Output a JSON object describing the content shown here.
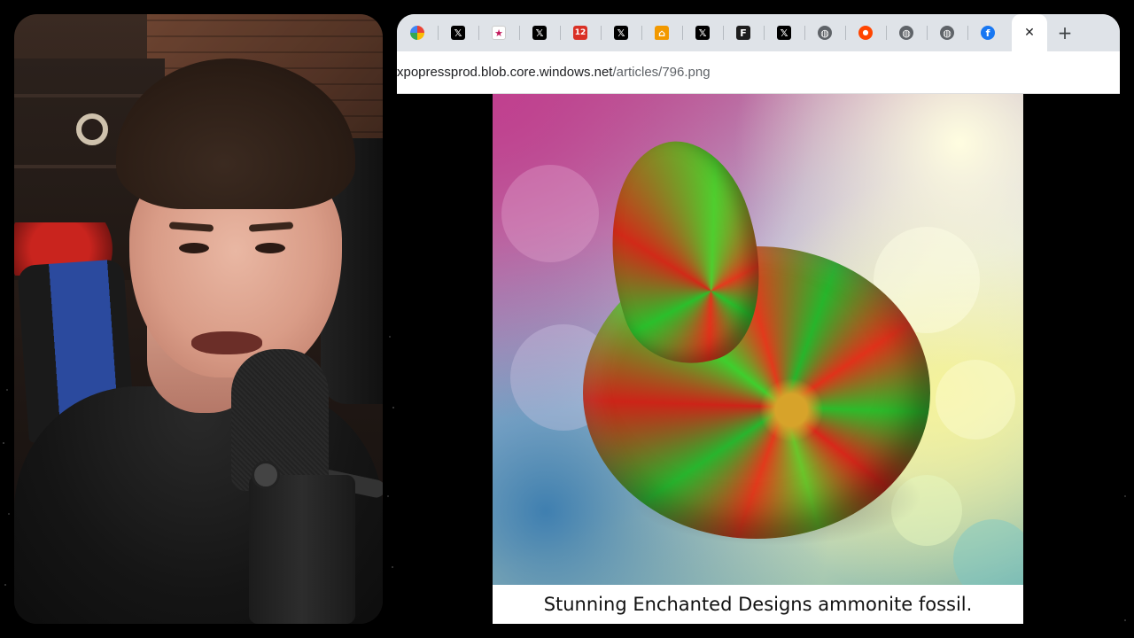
{
  "browser": {
    "tabs": [
      {
        "icon": "multicolor-app-icon",
        "glyph": ""
      },
      {
        "icon": "x-icon",
        "glyph": "𝕏"
      },
      {
        "icon": "star-logo-icon",
        "glyph": "★"
      },
      {
        "icon": "x-icon",
        "glyph": "𝕏"
      },
      {
        "icon": "news-logo-icon",
        "glyph": "12"
      },
      {
        "icon": "x-icon",
        "glyph": "𝕏"
      },
      {
        "icon": "home-icon",
        "glyph": "⌂"
      },
      {
        "icon": "x-icon",
        "glyph": "𝕏"
      },
      {
        "icon": "flipboard-icon",
        "glyph": "F"
      },
      {
        "icon": "x-icon",
        "glyph": "𝕏"
      },
      {
        "icon": "globe-icon",
        "glyph": "◍"
      },
      {
        "icon": "reddit-icon",
        "glyph": "●"
      },
      {
        "icon": "globe-icon",
        "glyph": "◍"
      },
      {
        "icon": "globe-icon",
        "glyph": "◍"
      },
      {
        "icon": "facebook-icon",
        "glyph": "f"
      }
    ],
    "active_tab_close": "✕",
    "new_tab": "+",
    "url": {
      "host": "xpopressprod.blob.core.windows.net",
      "path": "/articles/796.png"
    }
  },
  "content": {
    "caption": "Stunning Enchanted Designs ammonite fossil."
  }
}
